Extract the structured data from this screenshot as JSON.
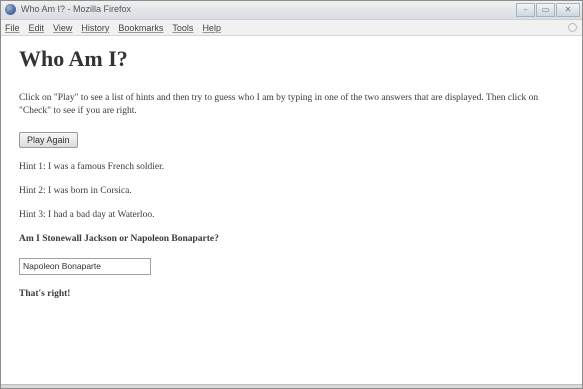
{
  "window": {
    "title": "Who Am I? - Mozilla Firefox",
    "controls": {
      "minimize": "–",
      "maximize": "▭",
      "close": "✕"
    }
  },
  "menubar": {
    "items": [
      "File",
      "Edit",
      "View",
      "History",
      "Bookmarks",
      "Tools",
      "Help"
    ]
  },
  "page": {
    "title": "Who Am I?",
    "instructions": "Click on \"Play\" to see a list of hints and then try to guess who I am by typing in one of the two answers that are displayed. Then click on \"Check\" to see if you are right.",
    "play_again_label": "Play Again",
    "hints": [
      "Hint 1: I was a famous French soldier.",
      "Hint 2: I was born in Corsica.",
      "Hint 3: I had a bad day at Waterloo."
    ],
    "question": "Am I Stonewall Jackson or Napoleon Bonaparte?",
    "answer_value": "Napoleon Bonaparte",
    "result": "That's right!"
  }
}
